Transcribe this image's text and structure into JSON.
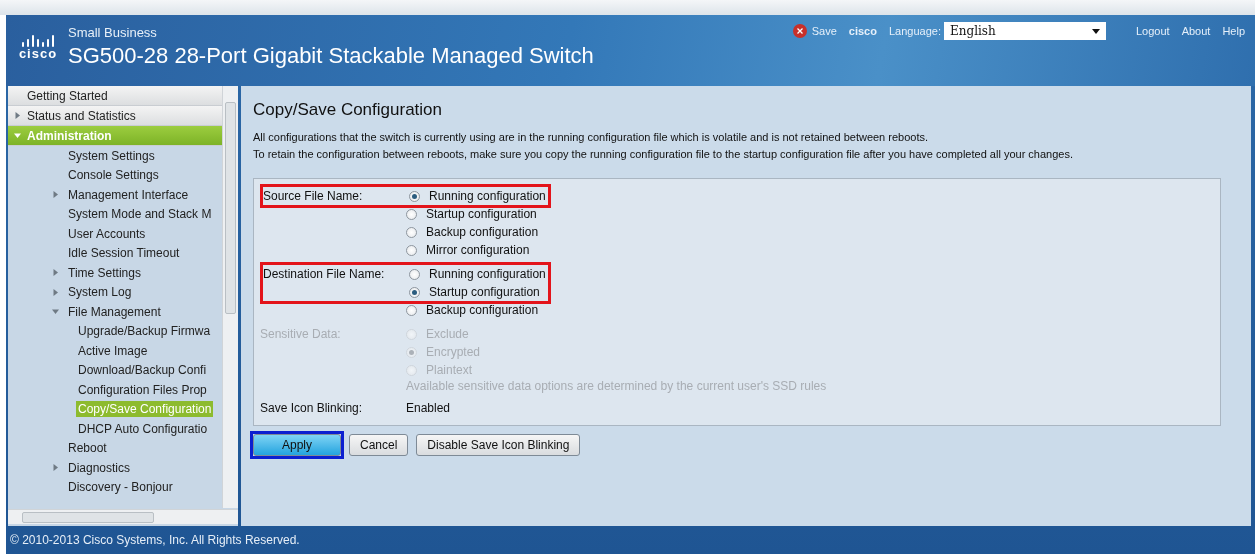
{
  "header": {
    "logo": "cisco",
    "tagline": "Small Business",
    "title": "SG500-28 28-Port Gigabit Stackable Managed Switch",
    "save_link": "Save",
    "user": "cisco",
    "language_label": "Language:",
    "language": "English",
    "links": [
      "Logout",
      "About",
      "Help"
    ]
  },
  "sidebar": {
    "items": [
      {
        "kind": "section",
        "label": "Getting Started",
        "selected": false
      },
      {
        "kind": "section",
        "label": "Status and Statistics",
        "selected": false,
        "expanded": false
      },
      {
        "kind": "section",
        "label": "Administration",
        "selected": true,
        "expanded": true,
        "children": [
          {
            "label": "System Settings",
            "selected": false
          },
          {
            "label": "Console Settings",
            "selected": false
          },
          {
            "label": "Management Interface",
            "selected": false,
            "expanded": false
          },
          {
            "label": "System Mode and Stack M",
            "selected": false
          },
          {
            "label": "User Accounts",
            "selected": false
          },
          {
            "label": "Idle Session Timeout",
            "selected": false
          },
          {
            "label": "Time Settings",
            "selected": false,
            "expanded": false
          },
          {
            "label": "System Log",
            "selected": false,
            "expanded": false
          },
          {
            "label": "File Management",
            "selected": false,
            "expanded": true,
            "children": [
              {
                "label": "Upgrade/Backup Firmwa",
                "selected": false
              },
              {
                "label": "Active Image",
                "selected": false
              },
              {
                "label": "Download/Backup Confi",
                "selected": false
              },
              {
                "label": "Configuration Files Prop",
                "selected": false
              },
              {
                "label": "Copy/Save Configuration",
                "selected": true
              },
              {
                "label": "DHCP Auto Configuratio",
                "selected": false
              }
            ]
          },
          {
            "label": "Reboot",
            "selected": false
          },
          {
            "label": "Diagnostics",
            "selected": false,
            "expanded": false
          },
          {
            "label": "Discovery - Bonjour",
            "selected": false
          }
        ]
      }
    ]
  },
  "page": {
    "title": "Copy/Save Configuration",
    "description": [
      "All configurations that the switch is currently using are in the running configuration file which is volatile and is not retained between reboots.",
      "To retain the configuration between reboots, make sure you copy the running configuration file to the startup configuration file after you have completed all your changes."
    ],
    "fields": [
      {
        "kind": "radio",
        "label": "Source File Name:",
        "disabled": false,
        "options": [
          {
            "label": "Running configuration",
            "selected": true,
            "highlighted": true
          },
          {
            "label": "Startup configuration",
            "selected": false,
            "highlighted": false
          },
          {
            "label": "Backup configuration",
            "selected": false,
            "highlighted": false
          },
          {
            "label": "Mirror configuration",
            "selected": false,
            "highlighted": false
          }
        ]
      },
      {
        "kind": "radio",
        "label": "Destination File Name:",
        "disabled": false,
        "options": [
          {
            "label": "Running configuration",
            "selected": false,
            "highlighted": true
          },
          {
            "label": "Startup configuration",
            "selected": true,
            "highlighted": true
          },
          {
            "label": "Backup configuration",
            "selected": false,
            "highlighted": false
          }
        ]
      },
      {
        "kind": "radio",
        "label": "Sensitive Data:",
        "disabled": true,
        "note": "Available sensitive data options are determined by the current user's SSD rules",
        "options": [
          {
            "label": "Exclude",
            "selected": false,
            "highlighted": false
          },
          {
            "label": "Encrypted",
            "selected": true,
            "highlighted": false
          },
          {
            "label": "Plaintext",
            "selected": false,
            "highlighted": false
          }
        ]
      },
      {
        "kind": "text",
        "label": "Save Icon Blinking:",
        "value": "Enabled"
      }
    ],
    "buttons": [
      {
        "label": "Apply",
        "primary": true,
        "annotated": true
      },
      {
        "label": "Cancel",
        "primary": false,
        "annotated": false
      },
      {
        "label": "Disable Save Icon Blinking",
        "primary": false,
        "annotated": false
      }
    ]
  },
  "footer": "© 2010-2013 Cisco Systems, Inc. All Rights Reserved."
}
